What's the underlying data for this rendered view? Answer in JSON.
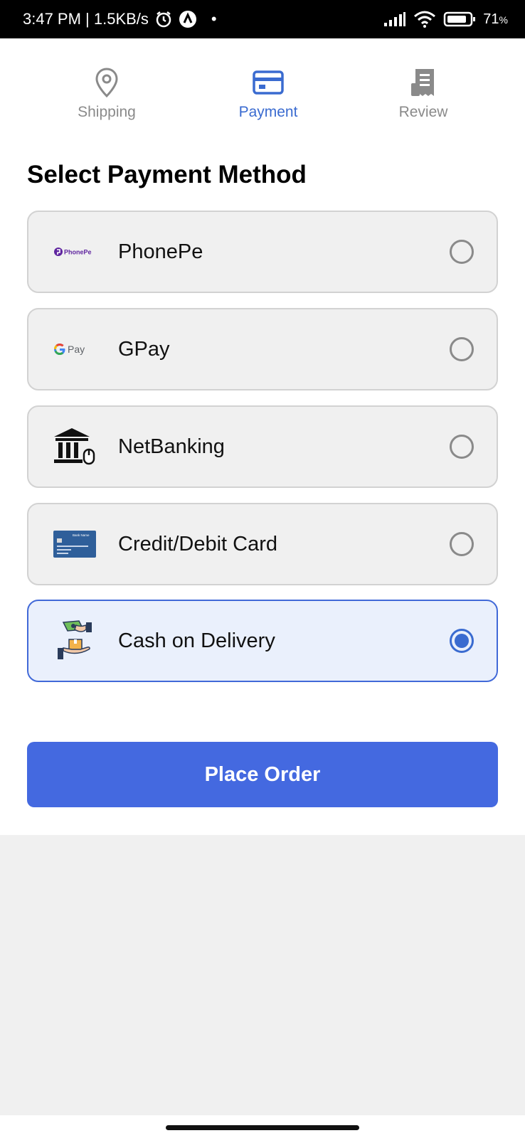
{
  "status_bar": {
    "time_speed": "3:47 PM | 1.5KB/s",
    "dot": "•",
    "battery": "71",
    "battery_unit": "%"
  },
  "steps": [
    {
      "label": "Shipping",
      "icon": "location-pin-icon",
      "active": false
    },
    {
      "label": "Payment",
      "icon": "credit-card-icon",
      "active": true
    },
    {
      "label": "Review",
      "icon": "receipt-icon",
      "active": false
    }
  ],
  "title": "Select Payment Method",
  "options": [
    {
      "label": "PhonePe",
      "logo": "phonepe-logo",
      "logo_text": "PhonePe",
      "selected": false
    },
    {
      "label": "GPay",
      "logo": "gpay-logo",
      "logo_text": "Pay",
      "selected": false
    },
    {
      "label": "NetBanking",
      "logo": "bank-icon",
      "selected": false
    },
    {
      "label": "Credit/Debit Card",
      "logo": "card-icon",
      "logo_text": "Bank Name",
      "selected": false
    },
    {
      "label": "Cash on Delivery",
      "logo": "cash-delivery-icon",
      "selected": true
    }
  ],
  "button": {
    "label": "Place Order"
  },
  "colors": {
    "accent": "#4469e0",
    "active_step": "#3a6bd0",
    "selected_bg": "#eaf0fc"
  }
}
